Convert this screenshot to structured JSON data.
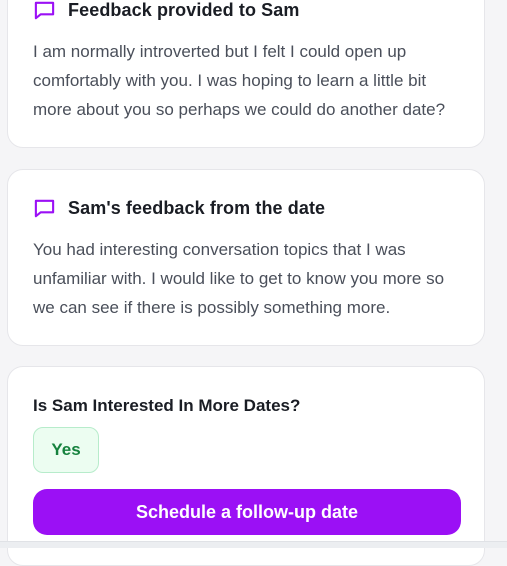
{
  "feedback_provided": {
    "title": "Feedback provided to Sam",
    "icon": "message-square-icon",
    "text": "I am normally introverted but I felt I could open up comfortably with you. I was hoping to learn a little bit more about you so perhaps we could do another date?"
  },
  "feedback_received": {
    "title": "Sam's feedback from the date",
    "icon": "message-square-icon",
    "text": "You had interesting conversation topics that I was unfamiliar with. I would like to get to know you more so we can see if there is possibly something more."
  },
  "interest": {
    "question": "Is Sam Interested In More Dates?",
    "answer": "Yes",
    "action_label": "Schedule a follow-up date"
  },
  "colors": {
    "accent": "#9b10f5",
    "yes_badge_bg": "#ecfdf1",
    "yes_badge_text": "#16823e"
  }
}
